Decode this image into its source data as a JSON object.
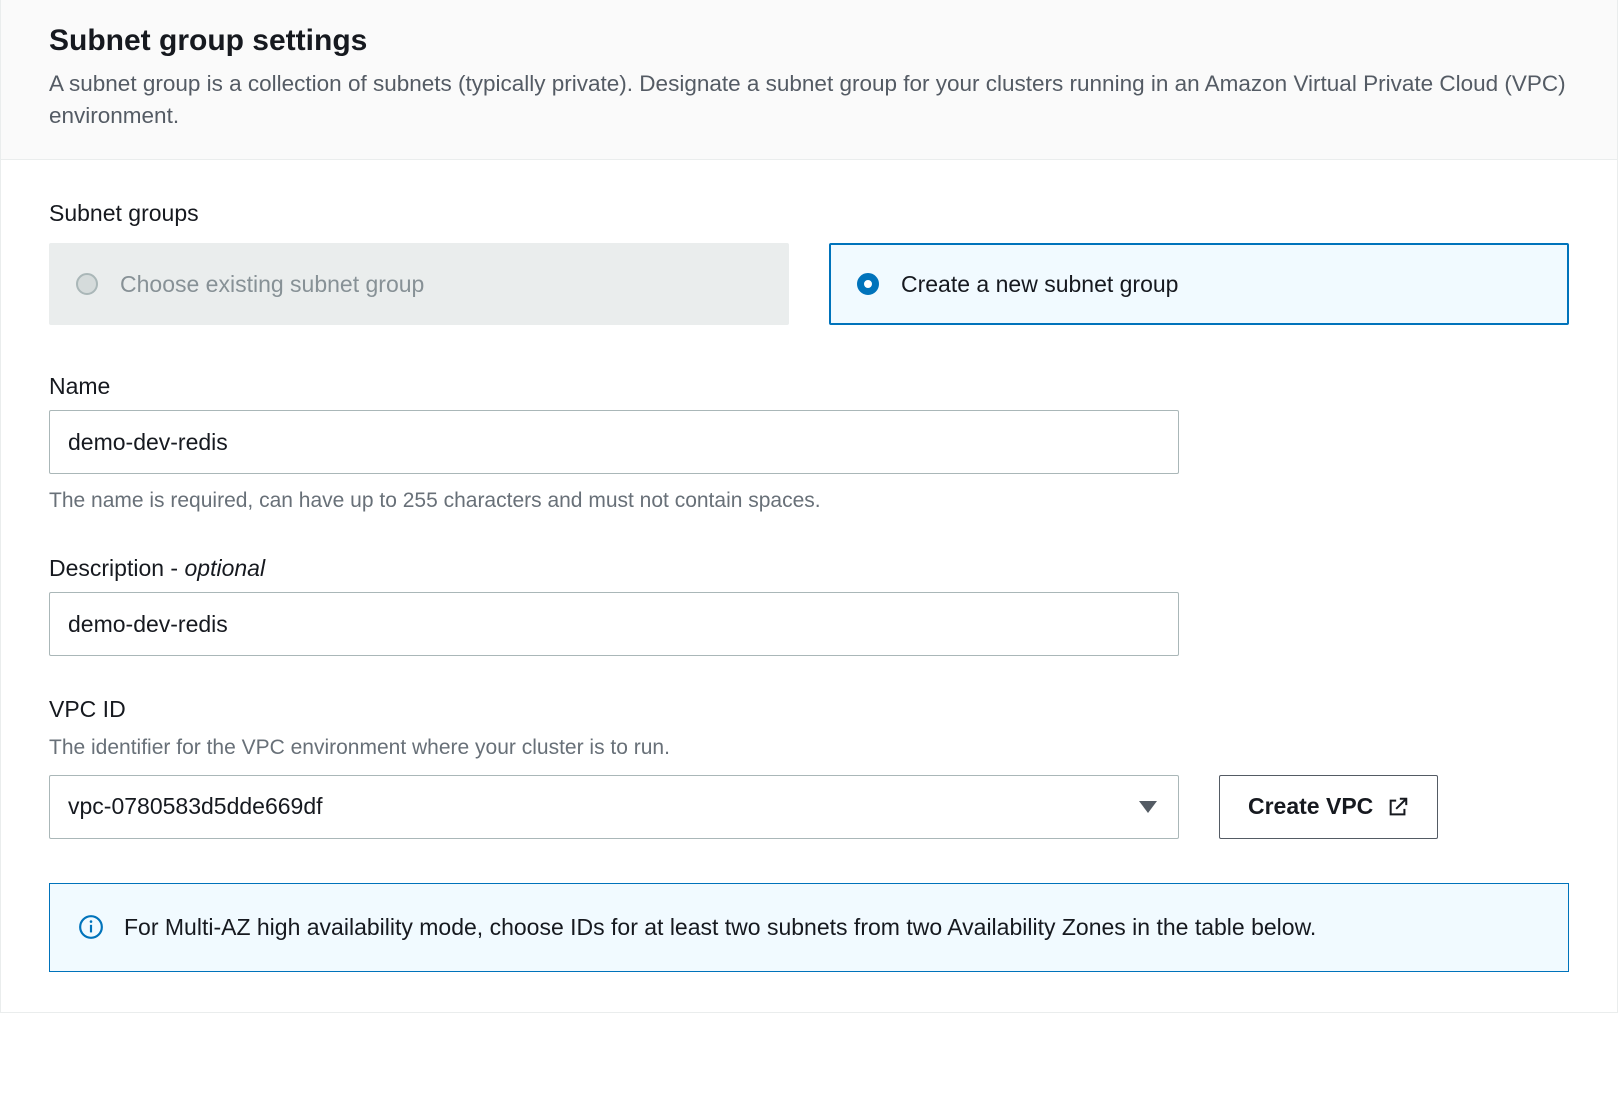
{
  "header": {
    "title": "Subnet group settings",
    "subtitle": "A subnet group is a collection of subnets (typically private). Designate a subnet group for your clusters running in an Amazon Virtual Private Cloud (VPC) environment."
  },
  "subnetGroups": {
    "section_label": "Subnet groups",
    "options": {
      "existing": {
        "label": "Choose existing subnet group",
        "enabled": false,
        "selected": false
      },
      "create": {
        "label": "Create a new subnet group",
        "enabled": true,
        "selected": true
      }
    }
  },
  "name": {
    "label": "Name",
    "value": "demo-dev-redis",
    "hint": "The name is required, can have up to 255 characters and must not contain spaces."
  },
  "description": {
    "label_main": "Description",
    "label_suffix": " - ",
    "label_optional": "optional",
    "value": "demo-dev-redis"
  },
  "vpc": {
    "label": "VPC ID",
    "hint": "The identifier for the VPC environment where your cluster is to run.",
    "selected": "vpc-0780583d5dde669df",
    "create_button": "Create VPC"
  },
  "info": {
    "text": "For Multi-AZ high availability mode, choose IDs for at least two subnets from two Availability Zones in the table below."
  }
}
